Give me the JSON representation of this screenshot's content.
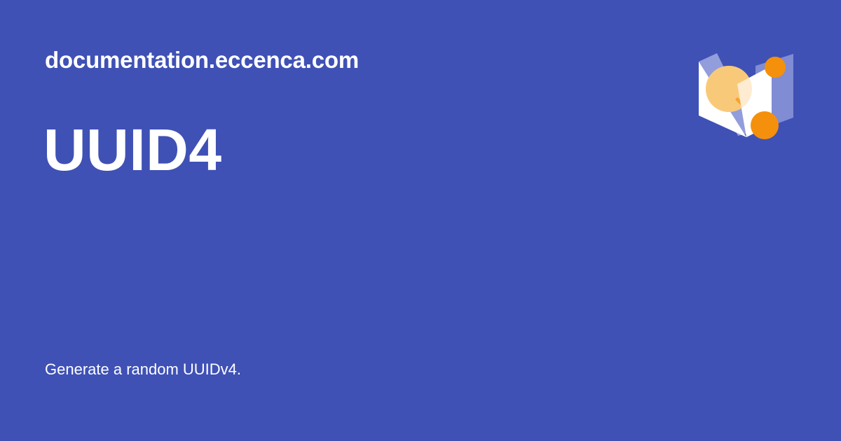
{
  "theme": {
    "background": "#3f51b5",
    "text": "#ffffff",
    "logo_orange": "#f5900c",
    "logo_peach": "#f9c97a",
    "logo_lavender": "#a8b0e6"
  },
  "header": {
    "site_name": "documentation.eccenca.com"
  },
  "page": {
    "title": "UUID4",
    "description": "Generate a random UUIDv4."
  },
  "logo": {
    "icon": "eccenca-logo-icon"
  }
}
